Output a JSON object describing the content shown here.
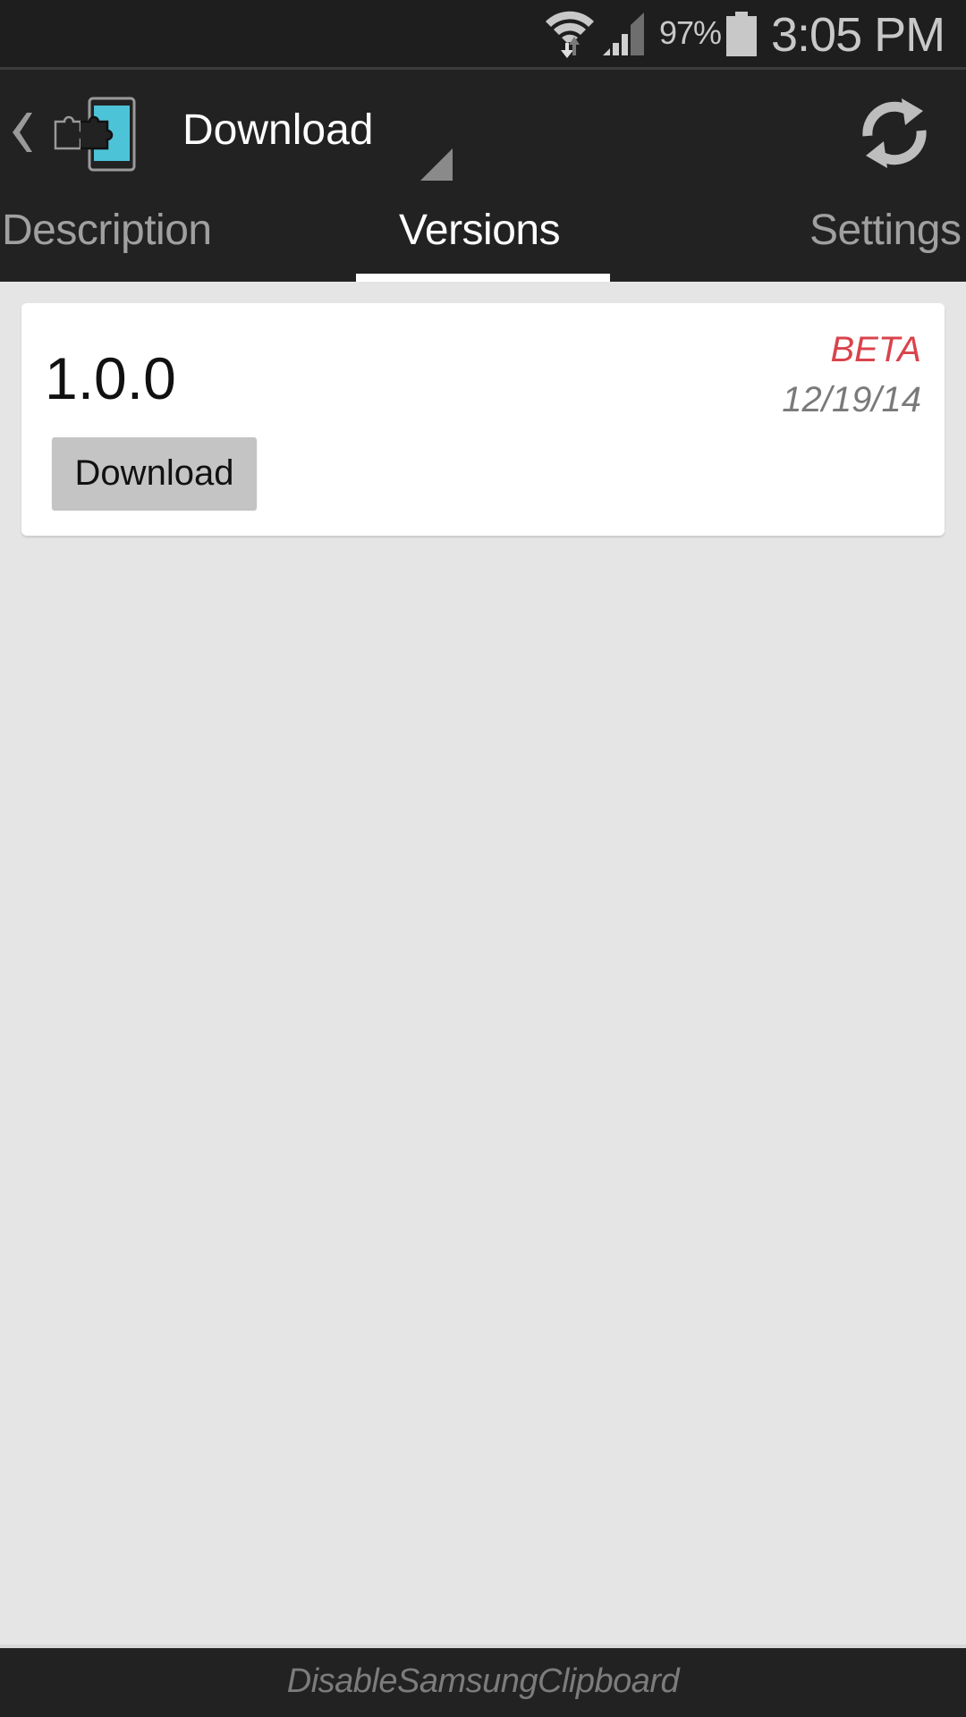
{
  "status_bar": {
    "battery_percent": "97%",
    "time": "3:05 PM",
    "icons": [
      "wifi-icon",
      "signal-icon",
      "battery-icon"
    ]
  },
  "action_bar": {
    "title": "Download",
    "icons": [
      "back-chevron-icon",
      "app-puzzle-phone-icon",
      "spinner-arrow-icon",
      "refresh-icon"
    ]
  },
  "tabs": [
    {
      "label": "Description",
      "active": false
    },
    {
      "label": "Versions",
      "active": true
    },
    {
      "label": "Settings",
      "active": false
    }
  ],
  "versions": [
    {
      "version": "1.0.0",
      "channel": "BETA",
      "date": "12/19/14",
      "button_label": "Download"
    }
  ],
  "footer": {
    "module_name": "DisableSamsungClipboard"
  },
  "colors": {
    "bar_bg": "#222222",
    "content_bg": "#e5e5e5",
    "beta_red": "#d9434c",
    "accent_cyan": "#4dc3d8"
  }
}
